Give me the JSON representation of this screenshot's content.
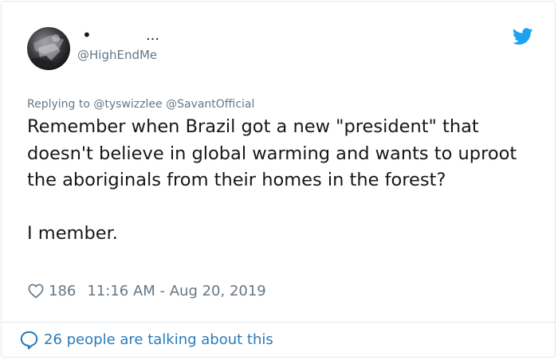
{
  "tweet": {
    "author": {
      "display_name_dot": "•",
      "display_name_ellipsis": "…",
      "handle": "@HighEndMe",
      "avatar_icon": "avatar-photo"
    },
    "replying_to": {
      "prefix": "Replying to",
      "mentions": [
        "@tyswizzlee",
        "@SavantOfficial"
      ]
    },
    "text": "Remember when Brazil got a new \"president\" that doesn't believe in global warming and wants to uproot the aboriginals from their homes in the forest?\n\nI member.",
    "likes": "186",
    "timestamp": "11:16 AM - Aug 20, 2019",
    "footer": "26 people are talking about this",
    "icons": {
      "brand": "twitter-bird-icon",
      "like": "heart-icon",
      "conversation": "speech-bubble-icon"
    },
    "colors": {
      "brand": "#1da1f2",
      "link": "#2b7bb9",
      "muted": "#657786",
      "text": "#14171a",
      "border": "#e1e8ed"
    }
  }
}
